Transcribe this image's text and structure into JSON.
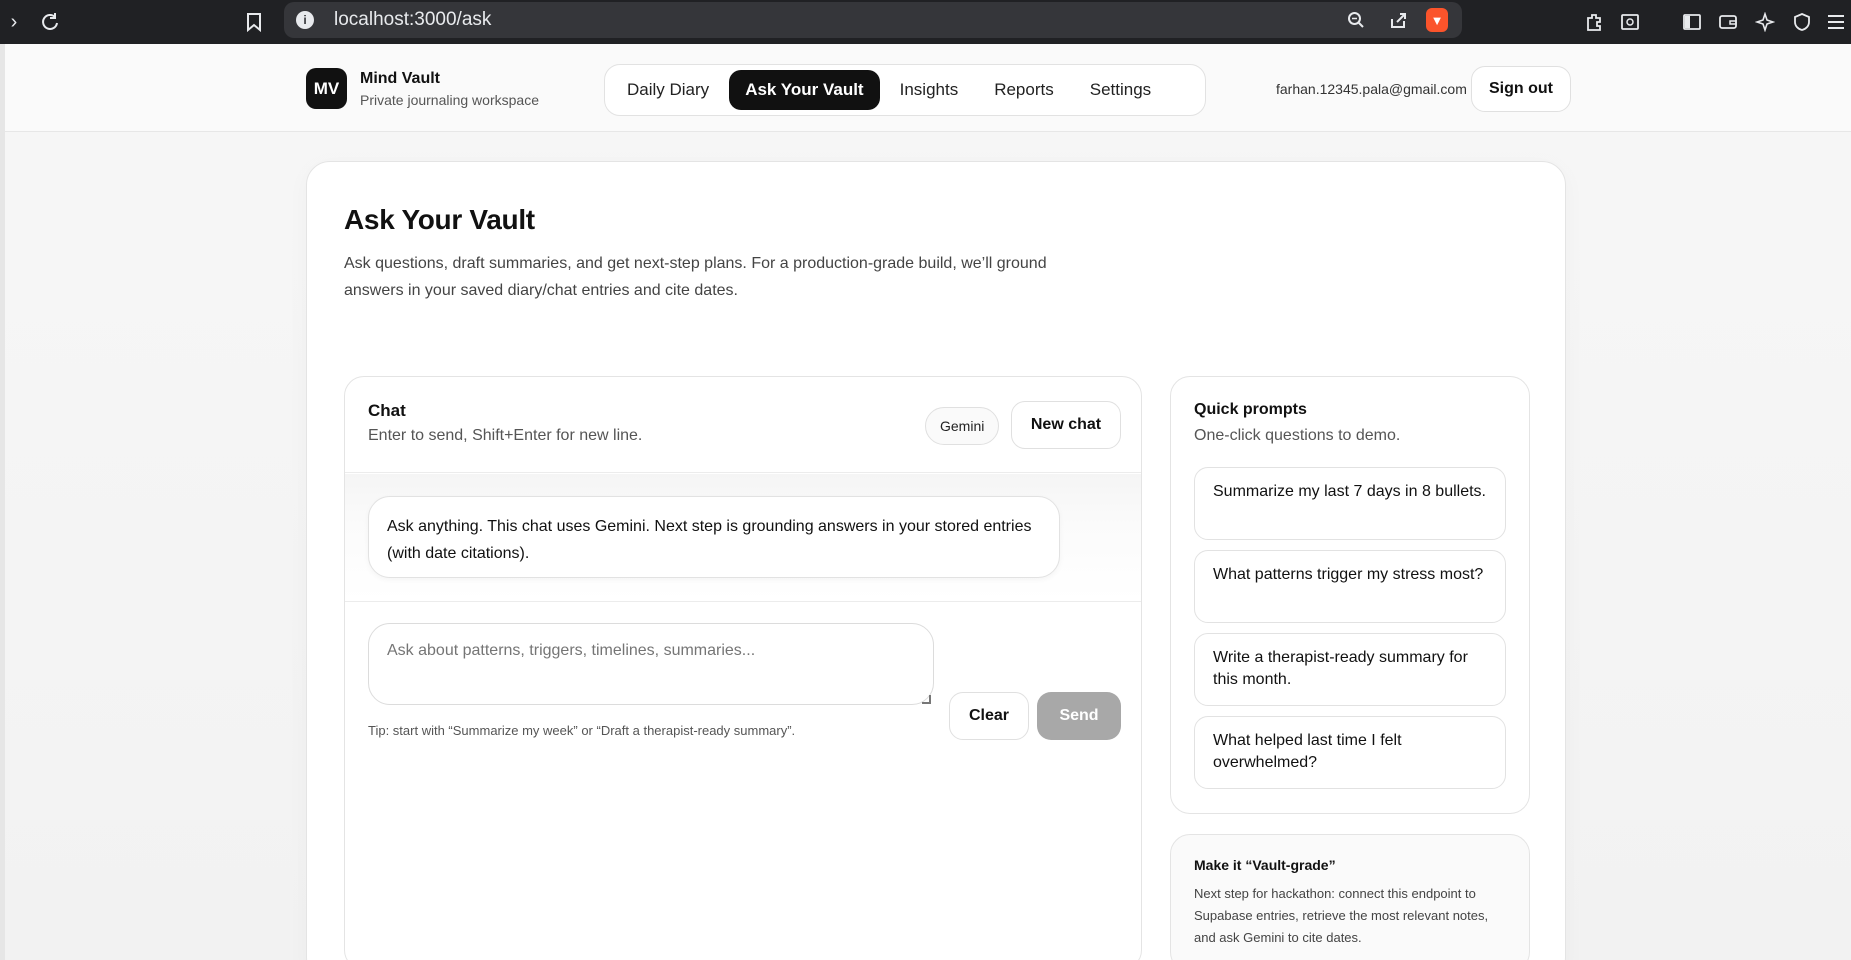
{
  "browser": {
    "url": "localhost:3000/ask",
    "info_glyph": "i"
  },
  "app": {
    "logo_initials": "MV",
    "name": "Mind Vault",
    "tagline": "Private journaling workspace",
    "nav": [
      {
        "label": "Daily Diary",
        "active": false
      },
      {
        "label": "Ask Your Vault",
        "active": true
      },
      {
        "label": "Insights",
        "active": false
      },
      {
        "label": "Reports",
        "active": false
      },
      {
        "label": "Settings",
        "active": false
      }
    ],
    "user_email": "farhan.12345.pala@gmail.com",
    "signout_label": "Sign out"
  },
  "page": {
    "title": "Ask Your Vault",
    "description": "Ask questions, draft summaries, and get next-step plans. For a production-grade build, we’ll ground answers in your saved diary/chat entries and cite dates."
  },
  "chat": {
    "title": "Chat",
    "subtitle": "Enter to send, Shift+Enter for new line.",
    "model_badge": "Gemini",
    "new_chat_label": "New chat",
    "messages": [
      {
        "role": "assistant",
        "text": "Ask anything. This chat uses Gemini. Next step is grounding answers in your stored entries (with date citations)."
      }
    ],
    "input_placeholder": "Ask about patterns, triggers, timelines, summaries...",
    "input_value": "",
    "tip": "Tip: start with “Summarize my week” or “Draft a therapist-ready summary”.",
    "clear_label": "Clear",
    "send_label": "Send"
  },
  "quick_prompts": {
    "title": "Quick prompts",
    "subtitle": "One-click questions to demo.",
    "items": [
      "Summarize my last 7 days in 8 bullets.",
      "What patterns trigger my stress most?",
      "Write a therapist-ready summary for this month.",
      "What helped last time I felt overwhelmed?"
    ]
  },
  "vault_grade": {
    "title": "Make it “Vault-grade”",
    "body": "Next step for hackathon: connect this endpoint to Supabase entries, retrieve the most relevant notes, and ask Gemini to cite dates."
  },
  "colors": {
    "accent": "#111111",
    "send_disabled": "#a8a8a8",
    "brave": "#fb542b"
  }
}
